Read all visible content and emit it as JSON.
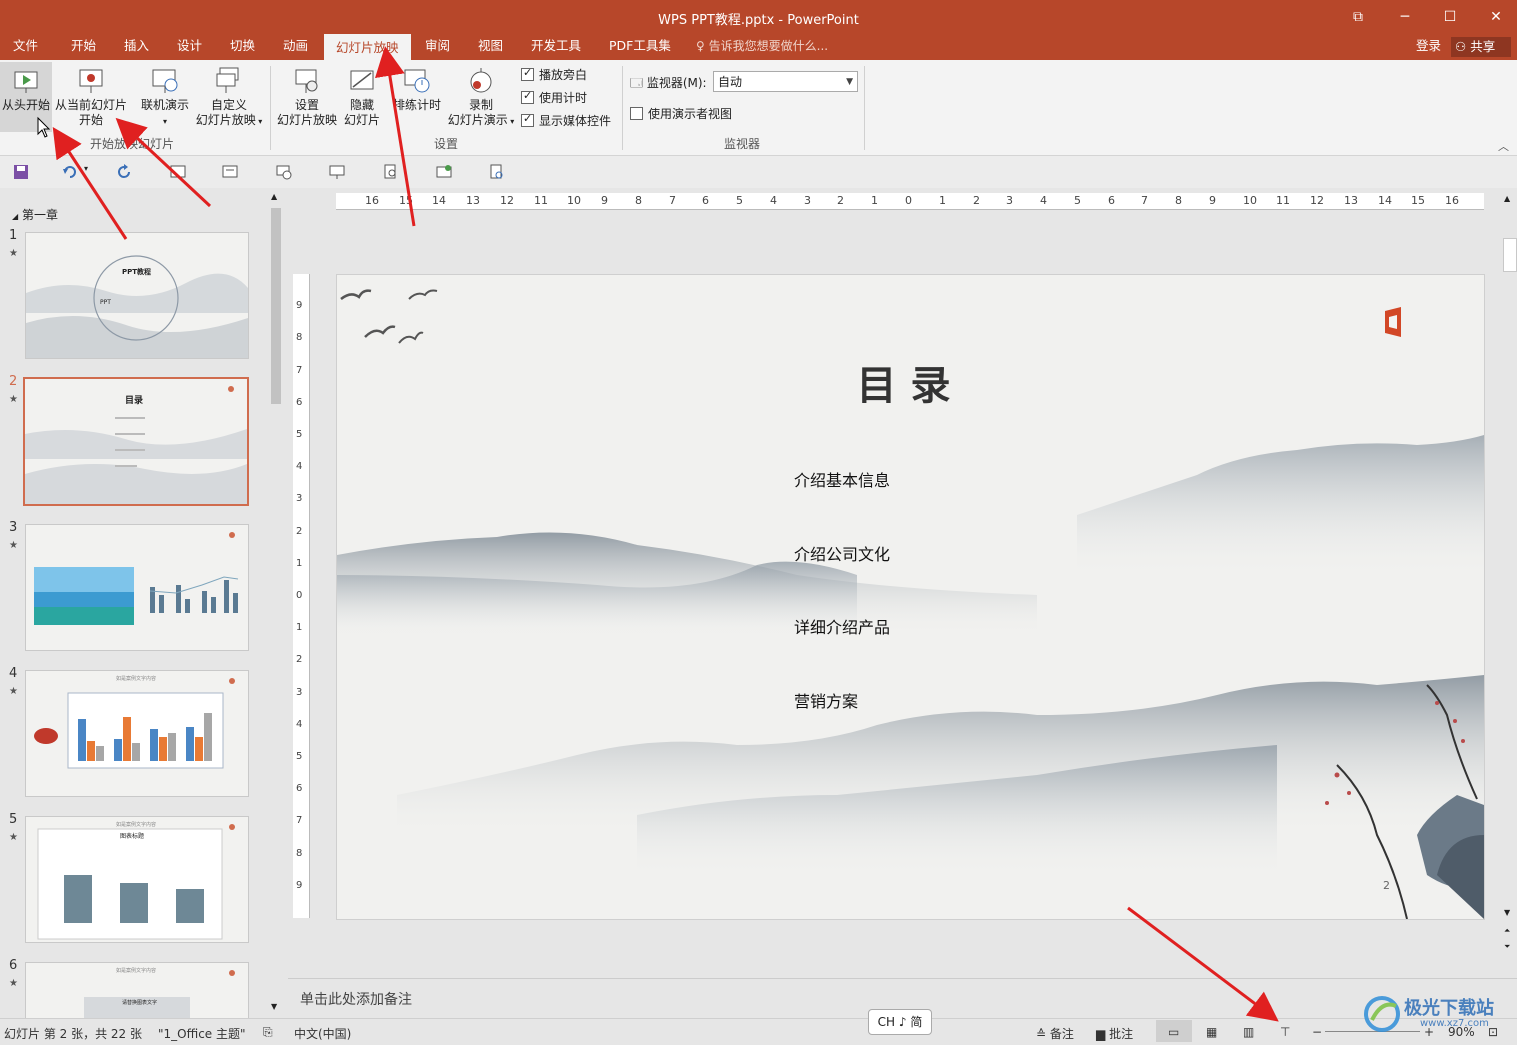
{
  "window": {
    "title": "WPS PPT教程.pptx - PowerPoint",
    "controls": [
      "restore-ribbon",
      "minimize",
      "maximize",
      "close"
    ]
  },
  "tabs": [
    {
      "label": "文件"
    },
    {
      "label": "开始"
    },
    {
      "label": "插入"
    },
    {
      "label": "设计"
    },
    {
      "label": "切换"
    },
    {
      "label": "动画"
    },
    {
      "label": "幻灯片放映",
      "active": true
    },
    {
      "label": "审阅"
    },
    {
      "label": "视图"
    },
    {
      "label": "开发工具"
    },
    {
      "label": "PDF工具集"
    }
  ],
  "tell_me": "告诉我您想要做什么...",
  "account": {
    "login": "登录",
    "share": "共享"
  },
  "ribbon": {
    "start_group": {
      "from_beginning": "从头开始",
      "from_current_1": "从当前幻灯片",
      "from_current_2": "开始",
      "online": "联机演示",
      "custom_1": "自定义",
      "custom_2": "幻灯片放映",
      "label": "开始放映幻灯片"
    },
    "setup_group": {
      "setup_1": "设置",
      "setup_2": "幻灯片放映",
      "hide_1": "隐藏",
      "hide_2": "幻灯片",
      "rehearse": "排练计时",
      "record_1": "录制",
      "record_2": "幻灯片演示",
      "play_narration": "播放旁白",
      "use_timings": "使用计时",
      "show_media": "显示媒体控件",
      "label": "设置"
    },
    "monitor_group": {
      "monitor_label": "监视器(M):",
      "monitor_value": "自动",
      "presenter_view": "使用演示者视图",
      "label": "监视器"
    }
  },
  "outline": {
    "section": "第一章",
    "slides": [
      {
        "num": "1"
      },
      {
        "num": "2",
        "selected": true
      },
      {
        "num": "3"
      },
      {
        "num": "4"
      },
      {
        "num": "5"
      },
      {
        "num": "6"
      }
    ],
    "thumb_text": {
      "s1_title": "PPT教程",
      "s1_sub": "PPT",
      "s2_title": "目录",
      "s4_title": "如是案例文字内容",
      "s5_title": "如是案例文字内容",
      "s5_chart": "图表标题",
      "s6_title": "如是案例文字内容",
      "s6_text": "请替换图表文字"
    }
  },
  "ruler": {
    "h_labels": [
      "16",
      "15",
      "14",
      "13",
      "12",
      "11",
      "10",
      "9",
      "8",
      "7",
      "6",
      "5",
      "4",
      "3",
      "2",
      "1",
      "0",
      "1",
      "2",
      "3",
      "4",
      "5",
      "6",
      "7",
      "8",
      "9",
      "10",
      "11",
      "12",
      "13",
      "14",
      "15",
      "16"
    ],
    "v_labels": [
      "9",
      "8",
      "7",
      "6",
      "5",
      "4",
      "3",
      "2",
      "1",
      "0",
      "1",
      "2",
      "3",
      "4",
      "5",
      "6",
      "7",
      "8",
      "9"
    ]
  },
  "slide": {
    "title": "目录",
    "items": [
      "介绍基本信息",
      "介绍公司文化",
      "详细介绍产品",
      "营销方案"
    ],
    "page_number": "2"
  },
  "notes_placeholder": "单击此处添加备注",
  "status": {
    "slide_info": "幻灯片 第 2 张，共 22 张",
    "theme": "\"1_Office 主题\"",
    "language": "中文(中国)",
    "notes": "备注",
    "comments": "批注",
    "zoom": "90%"
  },
  "ime": "CH ♪ 简",
  "watermark": "极光下载站",
  "watermark_url": "www.xz7.com",
  "colors": {
    "accent": "#b7472a",
    "arrow": "#e02020",
    "selected_border": "#d06c4e"
  }
}
